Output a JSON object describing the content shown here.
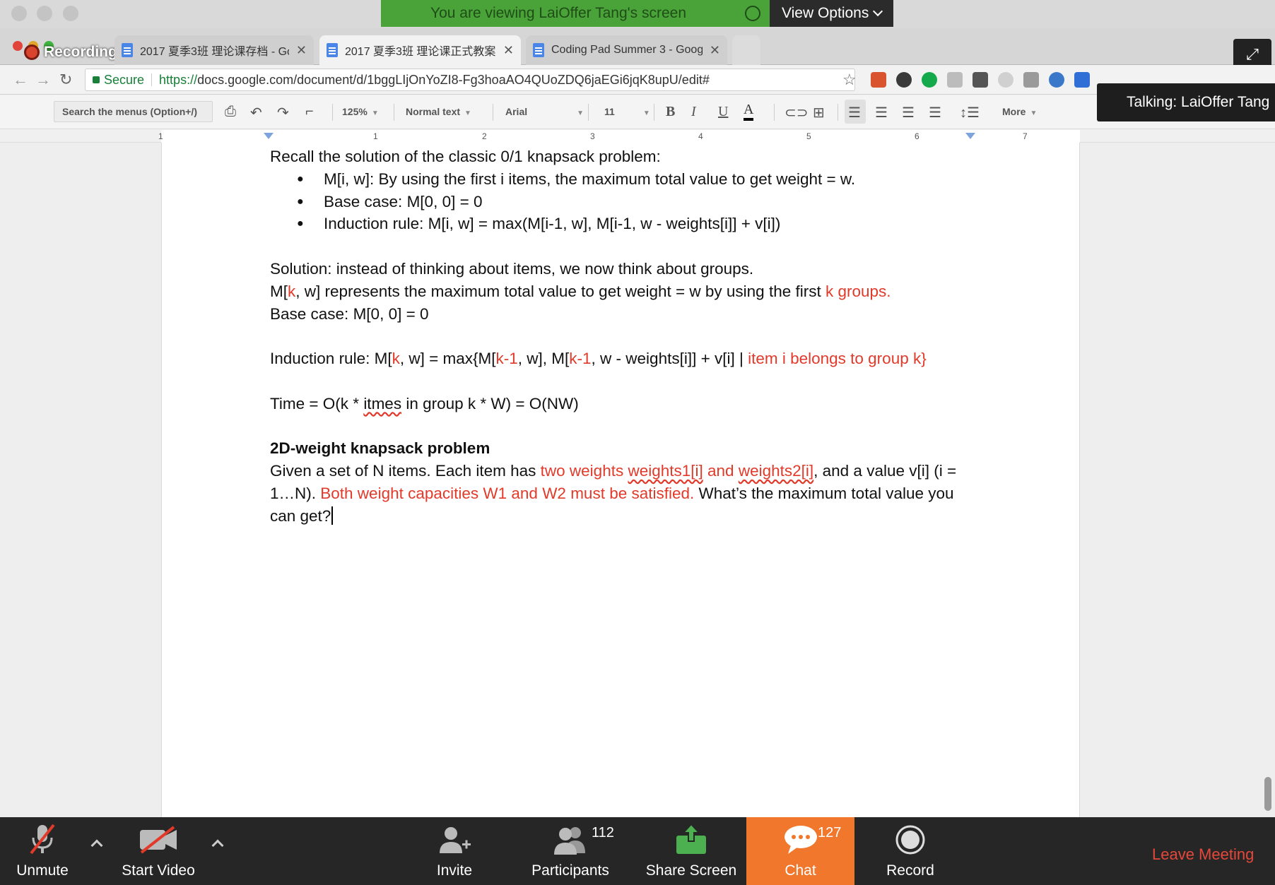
{
  "share_banner": {
    "text": "You are viewing LaiOffer Tang's screen",
    "view_options": "View Options"
  },
  "recording_label": "Recording",
  "tabs": [
    {
      "title": "2017 夏季3班 理论课存档 - Go",
      "active": false
    },
    {
      "title": "2017 夏季3班 理论课正式教案",
      "active": true
    },
    {
      "title": "Coding Pad Summer 3 - Goog",
      "active": false
    }
  ],
  "address": {
    "secure_label": "Secure",
    "url_prefix": "https://",
    "url_rest": "docs.google.com/document/d/1bggLIjOnYoZI8-Fg3hoaAO4QUoZDQ6jaEGi6jqK8upU/edit#"
  },
  "toolbar": {
    "search_menus": "Search the menus (Option+/)",
    "zoom": "125%",
    "style": "Normal text",
    "font": "Arial",
    "size": "11",
    "bold": "B",
    "italic": "I",
    "underline": "U",
    "text_color": "A",
    "more": "More"
  },
  "talking": "Talking: LaiOffer Tang",
  "ruler_numbers": [
    "1",
    "1",
    "2",
    "3",
    "4",
    "5",
    "6",
    "7"
  ],
  "doc": {
    "intro": "Recall the solution of the classic 0/1 knapsack problem:",
    "bullets": [
      "M[i, w]: By using the first i items, the maximum total value to get weight = w.",
      "Base case: M[0, 0] = 0",
      "Induction rule: M[i, w] = max(M[i-1, w], M[i-1, w - weights[i]] + v[i])"
    ],
    "solution": "Solution: instead of thinking about items, we now think about groups.",
    "m_line": {
      "a": "M[",
      "k": "k",
      "b": ", w] represents the maximum total value to get weight = w by using the first ",
      "k_groups": "k groups",
      "c": "."
    },
    "base_case": "Base case: M[0, 0] = 0",
    "induction": {
      "a": "Induction rule: M[",
      "k": "k",
      "b": ", w] = max{M[",
      "k1a": "k-1",
      "c": ", w], M[",
      "k1b": "k-1",
      "d": ", w - weights[i]] + v[i] | ",
      "belongs": "item i belongs to group k",
      "e": "}"
    },
    "time": {
      "a": "Time = O(k * ",
      "itmes": "itmes",
      "b": " in group k * W) = O(NW)"
    },
    "heading": "2D-weight knapsack problem",
    "given": {
      "a": "Given a set of N items. Each item has ",
      "two": "two weights ",
      "w1": "weights1[i]",
      "and": " and ",
      "w2": "weights2[i]",
      "b": ", and a value v[i] (i = 1…N). ",
      "both": "Both weight capacities W1 and W2 must be satisfied.",
      "c": " What’s the maximum total value you can get?"
    }
  },
  "zoom_bar": {
    "unmute": "Unmute",
    "start_video": "Start Video",
    "invite": "Invite",
    "participants": "Participants",
    "participants_count": "112",
    "share_screen": "Share Screen",
    "chat": "Chat",
    "chat_count": "127",
    "record": "Record",
    "leave": "Leave Meeting"
  }
}
